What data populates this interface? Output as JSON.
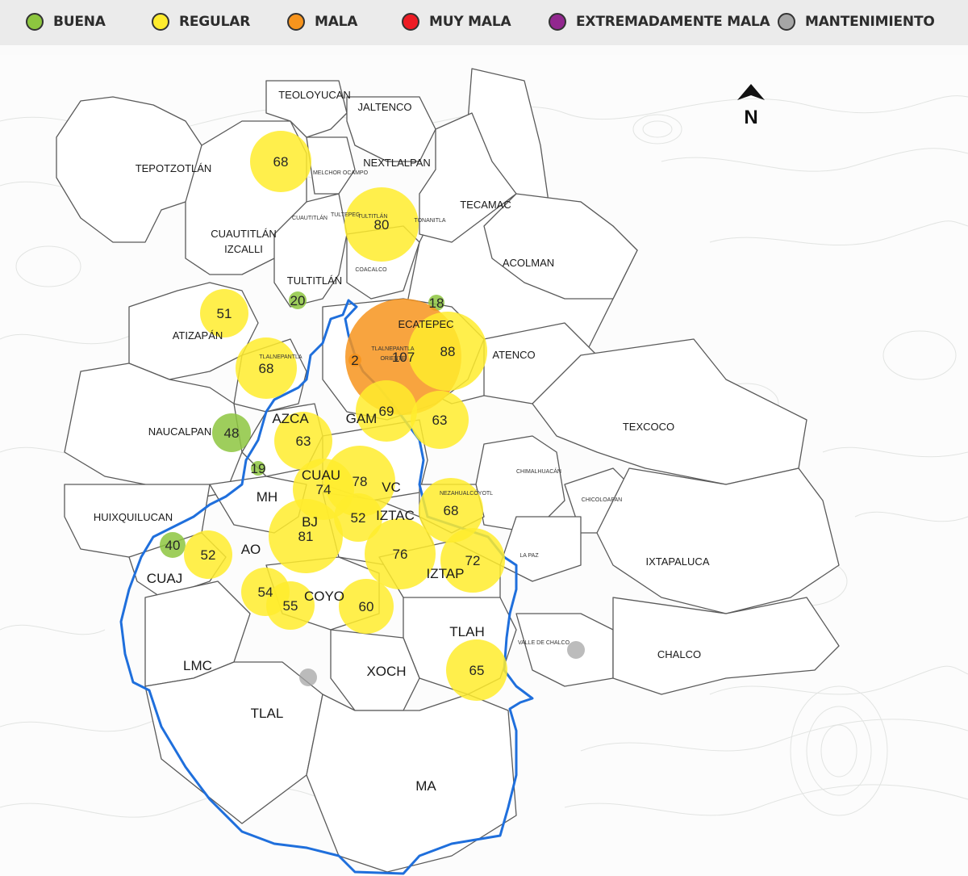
{
  "legend": {
    "items": [
      {
        "label": "BUENA",
        "color": "#8dc63f"
      },
      {
        "label": "REGULAR",
        "color": "#ffec2d"
      },
      {
        "label": "MALA",
        "color": "#f7941d"
      },
      {
        "label": "MUY MALA",
        "color": "#ed1c24"
      },
      {
        "label": "EXTREMADAMENTE MALA",
        "color": "#92278f"
      },
      {
        "label": "MANTENIMIENTO",
        "color": "#a6a6a6"
      }
    ]
  },
  "map": {
    "north_label": "N",
    "boundary_color": "#1f6fdc",
    "municipalities": [
      {
        "name": "TEOLOYUCAN",
        "size": "normal"
      },
      {
        "name": "JALTENCO",
        "size": "normal"
      },
      {
        "name": "TEPOTZOTLÁN",
        "size": "normal"
      },
      {
        "name": "NEXTLALPAN",
        "size": "normal"
      },
      {
        "name": "MELCHOR OCAMPO",
        "size": "tiny"
      },
      {
        "name": "TECAMAC",
        "size": "normal"
      },
      {
        "name": "CUAUTITLÁN",
        "size": "normal"
      },
      {
        "name": "IZCALLI",
        "size": "normal"
      },
      {
        "name": "CUAUTITLÁN",
        "size": "tiny"
      },
      {
        "name": "TULTEPEC",
        "size": "tiny"
      },
      {
        "name": "TULTITLÁN",
        "size": "tiny"
      },
      {
        "name": "TONANITLA",
        "size": "tiny"
      },
      {
        "name": "COACALCO",
        "size": "tiny"
      },
      {
        "name": "ACOLMAN",
        "size": "normal"
      },
      {
        "name": "TULTITLÁN",
        "size": "normal"
      },
      {
        "name": "ATIZAPÁN",
        "size": "normal"
      },
      {
        "name": "ECATEPEC",
        "size": "normal"
      },
      {
        "name": "TLALNEPANTLA",
        "size": "tiny"
      },
      {
        "name": "TLALNEPANTLA",
        "size": "tiny"
      },
      {
        "name": "ORIENTE",
        "size": "tiny"
      },
      {
        "name": "ATENCO",
        "size": "normal"
      },
      {
        "name": "AZCA",
        "size": "big"
      },
      {
        "name": "GAM",
        "size": "big"
      },
      {
        "name": "NAUCALPAN",
        "size": "normal"
      },
      {
        "name": "TEXCOCO",
        "size": "normal"
      },
      {
        "name": "CHIMALHUACÁN",
        "size": "tiny"
      },
      {
        "name": "CUAU",
        "size": "big"
      },
      {
        "name": "VC",
        "size": "big"
      },
      {
        "name": "NEZAHUALCÓYOTL",
        "size": "tiny"
      },
      {
        "name": "CHICOLOAPAN",
        "size": "tiny"
      },
      {
        "name": "MH",
        "size": "big"
      },
      {
        "name": "HUIXQUILUCAN",
        "size": "normal"
      },
      {
        "name": "IZTAC",
        "size": "big"
      },
      {
        "name": "BJ",
        "size": "big"
      },
      {
        "name": "AO",
        "size": "big"
      },
      {
        "name": "LA PAZ",
        "size": "tiny"
      },
      {
        "name": "IXTAPALUCA",
        "size": "normal"
      },
      {
        "name": "CUAJ",
        "size": "big"
      },
      {
        "name": "IZTAP",
        "size": "big"
      },
      {
        "name": "COYO",
        "size": "big"
      },
      {
        "name": "TLAH",
        "size": "big"
      },
      {
        "name": "VALLE DE CHALCO",
        "size": "tiny"
      },
      {
        "name": "CHALCO",
        "size": "normal"
      },
      {
        "name": "LMC",
        "size": "big"
      },
      {
        "name": "XOCH",
        "size": "big"
      },
      {
        "name": "TLAL",
        "size": "big"
      },
      {
        "name": "MA",
        "size": "big"
      }
    ],
    "stations": [
      {
        "value": "68",
        "category": "REGULAR"
      },
      {
        "value": "80",
        "category": "REGULAR"
      },
      {
        "value": "51",
        "category": "REGULAR"
      },
      {
        "value": "20",
        "category": "BUENA"
      },
      {
        "value": "18",
        "category": "BUENA"
      },
      {
        "value": "68",
        "category": "REGULAR"
      },
      {
        "value": "2",
        "category": "MALA"
      },
      {
        "value": "107",
        "category": "MALA"
      },
      {
        "value": "88",
        "category": "REGULAR"
      },
      {
        "value": "48",
        "category": "BUENA"
      },
      {
        "value": "69",
        "category": "REGULAR"
      },
      {
        "value": "63",
        "category": "REGULAR"
      },
      {
        "value": "63",
        "category": "REGULAR"
      },
      {
        "value": "19",
        "category": "BUENA"
      },
      {
        "value": "74",
        "category": "REGULAR"
      },
      {
        "value": "78",
        "category": "REGULAR"
      },
      {
        "value": "52",
        "category": "REGULAR"
      },
      {
        "value": "68",
        "category": "REGULAR"
      },
      {
        "value": "81",
        "category": "REGULAR"
      },
      {
        "value": "40",
        "category": "BUENA"
      },
      {
        "value": "52",
        "category": "REGULAR"
      },
      {
        "value": "76",
        "category": "REGULAR"
      },
      {
        "value": "72",
        "category": "REGULAR"
      },
      {
        "value": "54",
        "category": "REGULAR"
      },
      {
        "value": "55",
        "category": "REGULAR"
      },
      {
        "value": "60",
        "category": "REGULAR"
      },
      {
        "value": "65",
        "category": "REGULAR"
      },
      {
        "value": "",
        "category": "MANTENIMIENTO"
      },
      {
        "value": "",
        "category": "MANTENIMIENTO"
      }
    ]
  }
}
